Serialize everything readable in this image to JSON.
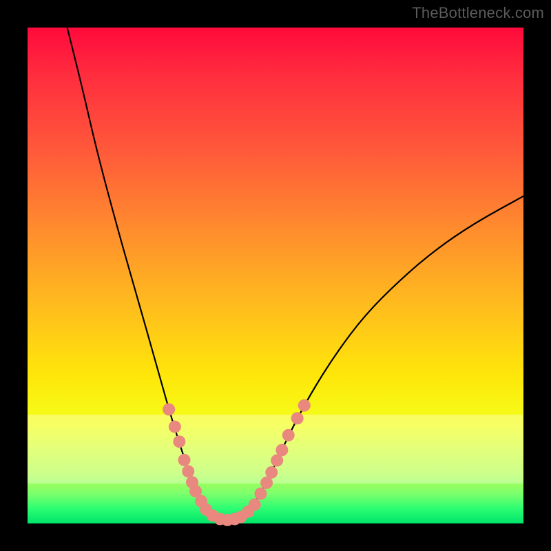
{
  "watermark": "TheBottleneck.com",
  "colors": {
    "curve_stroke": "#000000",
    "marker_fill": "#e8887f",
    "frame_bg": "#000000"
  },
  "pale_band": {
    "top_frac": 0.78,
    "height_frac": 0.14
  },
  "chart_data": {
    "type": "line",
    "title": "",
    "xlabel": "",
    "ylabel": "",
    "xlim": [
      0,
      100
    ],
    "ylim": [
      0,
      100
    ],
    "curve": [
      {
        "x": 8,
        "y": 100
      },
      {
        "x": 11,
        "y": 88
      },
      {
        "x": 14,
        "y": 75
      },
      {
        "x": 18,
        "y": 60
      },
      {
        "x": 22,
        "y": 46
      },
      {
        "x": 26,
        "y": 32
      },
      {
        "x": 28.5,
        "y": 23
      },
      {
        "x": 31,
        "y": 15
      },
      {
        "x": 33,
        "y": 9
      },
      {
        "x": 35,
        "y": 4.5
      },
      {
        "x": 37,
        "y": 1.8
      },
      {
        "x": 39,
        "y": 0.8
      },
      {
        "x": 41,
        "y": 0.7
      },
      {
        "x": 43,
        "y": 1.3
      },
      {
        "x": 45,
        "y": 3
      },
      {
        "x": 47,
        "y": 6
      },
      {
        "x": 50,
        "y": 12
      },
      {
        "x": 53,
        "y": 18.5
      },
      {
        "x": 57,
        "y": 26
      },
      {
        "x": 62,
        "y": 34
      },
      {
        "x": 68,
        "y": 42
      },
      {
        "x": 75,
        "y": 49
      },
      {
        "x": 82,
        "y": 55
      },
      {
        "x": 90,
        "y": 60.5
      },
      {
        "x": 100,
        "y": 66
      }
    ],
    "markers": [
      {
        "x": 28.5,
        "y": 23
      },
      {
        "x": 29.7,
        "y": 19.5
      },
      {
        "x": 30.6,
        "y": 16.5
      },
      {
        "x": 31.6,
        "y": 12.8
      },
      {
        "x": 32.4,
        "y": 10.5
      },
      {
        "x": 33.2,
        "y": 8.3
      },
      {
        "x": 33.9,
        "y": 6.5
      },
      {
        "x": 35.0,
        "y": 4.5
      },
      {
        "x": 36.0,
        "y": 2.8
      },
      {
        "x": 37.3,
        "y": 1.6
      },
      {
        "x": 38.8,
        "y": 0.9
      },
      {
        "x": 40.3,
        "y": 0.7
      },
      {
        "x": 41.8,
        "y": 0.9
      },
      {
        "x": 43.0,
        "y": 1.3
      },
      {
        "x": 44.5,
        "y": 2.4
      },
      {
        "x": 45.8,
        "y": 3.8
      },
      {
        "x": 47.0,
        "y": 6.0
      },
      {
        "x": 48.2,
        "y": 8.2
      },
      {
        "x": 49.2,
        "y": 10.3
      },
      {
        "x": 50.3,
        "y": 12.7
      },
      {
        "x": 51.3,
        "y": 14.8
      },
      {
        "x": 52.6,
        "y": 17.8
      },
      {
        "x": 54.4,
        "y": 21.2
      },
      {
        "x": 55.8,
        "y": 23.8
      }
    ]
  }
}
